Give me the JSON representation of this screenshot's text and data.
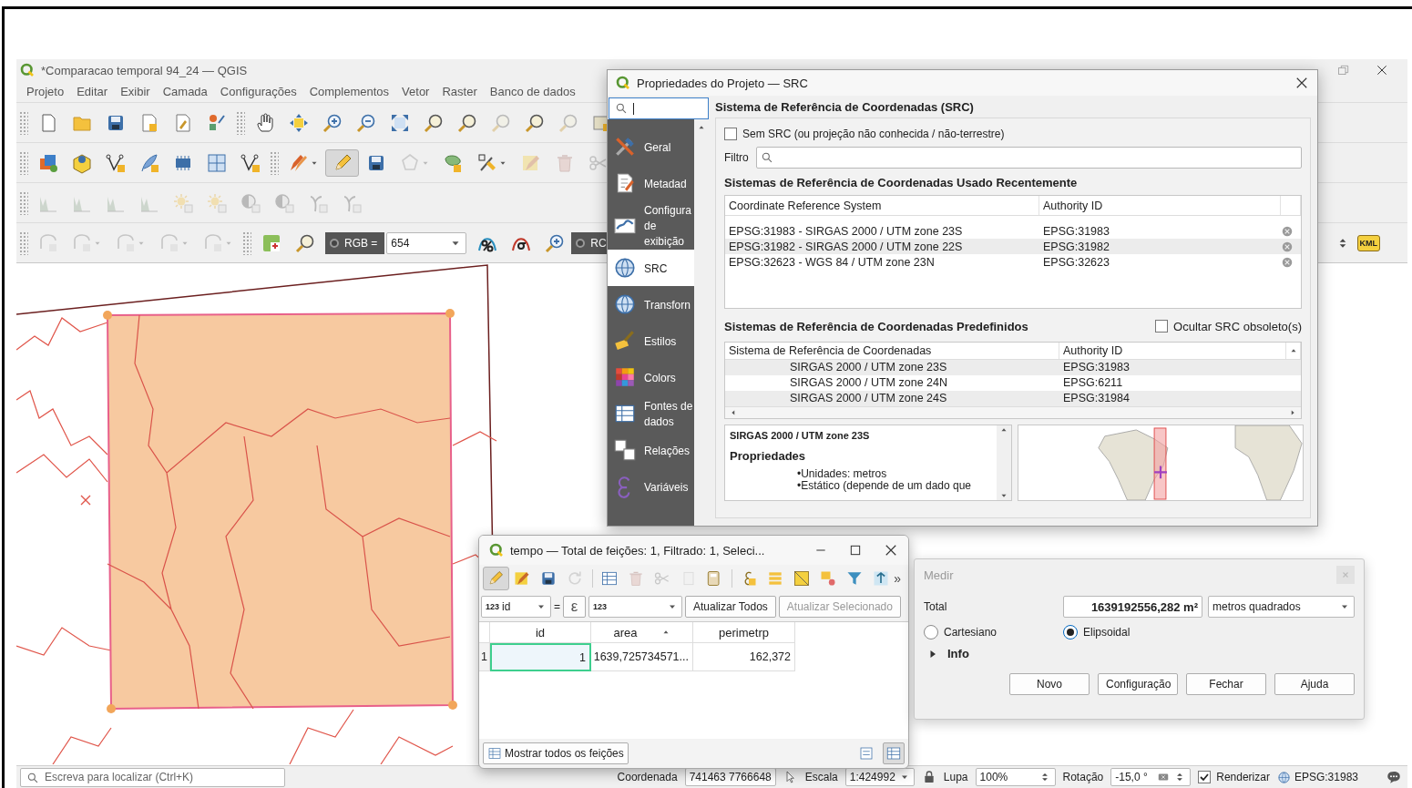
{
  "main_window": {
    "title": "*Comparacao temporal 94_24 — QGIS",
    "menu": [
      "Projeto",
      "Editar",
      "Exibir",
      "Camada",
      "Configurações",
      "Complementos",
      "Vetor",
      "Raster",
      "Banco de dados"
    ],
    "toolbars": [
      {
        "groups": [
          [
            {
              "kind": "page",
              "disabled": false,
              "active": false,
              "menu": false
            },
            {
              "kind": "folder",
              "disabled": false,
              "active": false,
              "menu": false
            },
            {
              "kind": "save",
              "disabled": false,
              "active": false,
              "menu": false
            },
            {
              "kind": "doc-gear",
              "disabled": false,
              "active": false,
              "menu": false
            },
            {
              "kind": "doc",
              "disabled": false,
              "active": false,
              "menu": false
            },
            {
              "kind": "style",
              "disabled": false,
              "active": false,
              "menu": false
            }
          ],
          [
            {
              "kind": "hand",
              "disabled": false,
              "active": false,
              "menu": false
            },
            {
              "kind": "pan",
              "disabled": false,
              "active": false,
              "menu": false
            },
            {
              "kind": "zoom-in",
              "disabled": false,
              "active": false,
              "menu": false
            },
            {
              "kind": "zoom-out",
              "disabled": false,
              "active": false,
              "menu": false
            },
            {
              "kind": "zoom-full",
              "disabled": false,
              "active": false,
              "menu": false
            },
            {
              "kind": "magnifier",
              "disabled": false,
              "active": false,
              "menu": false
            },
            {
              "kind": "magnifier",
              "disabled": false,
              "active": false,
              "menu": false
            },
            {
              "kind": "magnifier",
              "disabled": true,
              "active": false,
              "menu": false
            },
            {
              "kind": "magnifier",
              "disabled": false,
              "active": false,
              "menu": false
            },
            {
              "kind": "magnifier",
              "disabled": true,
              "active": false,
              "menu": false
            },
            {
              "kind": "map",
              "disabled": false,
              "active": false,
              "menu": false
            }
          ]
        ]
      },
      {
        "groups": [
          [
            {
              "kind": "layer",
              "disabled": false,
              "active": false,
              "menu": false
            },
            {
              "kind": "cube",
              "disabled": false,
              "active": false,
              "menu": false
            },
            {
              "kind": "vertex",
              "disabled": false,
              "active": false,
              "menu": false
            },
            {
              "kind": "feather",
              "disabled": false,
              "active": false,
              "menu": false
            },
            {
              "kind": "chip",
              "disabled": false,
              "active": false,
              "menu": false
            },
            {
              "kind": "grid",
              "disabled": false,
              "active": false,
              "menu": false
            },
            {
              "kind": "vertex",
              "disabled": false,
              "active": false,
              "menu": false
            }
          ],
          [
            {
              "kind": "pencils",
              "disabled": false,
              "active": false,
              "menu": true
            },
            {
              "kind": "pencil",
              "disabled": false,
              "active": true,
              "menu": false
            },
            {
              "kind": "save",
              "disabled": false,
              "active": false,
              "menu": false
            },
            {
              "kind": "polygon",
              "disabled": true,
              "active": false,
              "menu": true
            },
            {
              "kind": "blob",
              "disabled": false,
              "active": false,
              "menu": false
            },
            {
              "kind": "tool",
              "disabled": false,
              "active": false,
              "menu": true
            },
            {
              "kind": "edit-table",
              "disabled": true,
              "active": false,
              "menu": false
            },
            {
              "kind": "trash",
              "disabled": true,
              "active": false,
              "menu": false
            },
            {
              "kind": "scissors",
              "disabled": true,
              "active": false,
              "menu": false
            }
          ]
        ]
      },
      {
        "groups": [
          [
            {
              "kind": "histogram",
              "disabled": true,
              "active": false,
              "menu": false
            },
            {
              "kind": "histogram",
              "disabled": true,
              "active": false,
              "menu": false
            },
            {
              "kind": "histogram",
              "disabled": true,
              "active": false,
              "menu": false
            },
            {
              "kind": "histogram",
              "disabled": true,
              "active": false,
              "menu": false
            },
            {
              "kind": "sun",
              "disabled": true,
              "active": false,
              "menu": false
            },
            {
              "kind": "sun",
              "disabled": true,
              "active": false,
              "menu": false
            },
            {
              "kind": "circle",
              "disabled": true,
              "active": false,
              "menu": false
            },
            {
              "kind": "circle",
              "disabled": true,
              "active": false,
              "menu": false
            },
            {
              "kind": "gamma",
              "disabled": true,
              "active": false,
              "menu": false
            },
            {
              "kind": "gamma",
              "disabled": true,
              "active": false,
              "menu": false
            }
          ]
        ]
      },
      {
        "groups": [
          [
            {
              "kind": "shape",
              "disabled": true,
              "active": false,
              "menu": false
            },
            {
              "kind": "shape",
              "disabled": true,
              "active": false,
              "menu": true
            },
            {
              "kind": "shape",
              "disabled": true,
              "active": false,
              "menu": true
            },
            {
              "kind": "shape",
              "disabled": true,
              "active": false,
              "menu": true
            },
            {
              "kind": "shape",
              "disabled": true,
              "active": false,
              "menu": true
            }
          ],
          [
            {
              "kind": "raster",
              "disabled": false,
              "active": false,
              "menu": false
            },
            {
              "kind": "magnifier",
              "disabled": false,
              "active": false,
              "menu": false
            },
            {
              "kind": "rgb-filter",
              "label": "RGB =",
              "value": "654"
            },
            {
              "kind": "percent",
              "disabled": false,
              "active": false,
              "menu": false
            },
            {
              "kind": "sigma",
              "disabled": false,
              "active": false,
              "menu": false
            },
            {
              "kind": "zoom-in",
              "disabled": false,
              "active": false,
              "menu": false
            },
            {
              "kind": "cut-filter",
              "label": "RC"
            }
          ]
        ],
        "right_items": [
          {
            "kind": "spinner"
          },
          {
            "kind": "kml",
            "label": "KML"
          }
        ]
      }
    ],
    "status_bar": {
      "locator_placeholder": "Escreva para localizar (Ctrl+K)",
      "coordinate_label": "Coordenada",
      "coordinate": "741463 7766648",
      "scale_label": "Escala",
      "scale": "1:424992",
      "magnifier_label": "Lupa",
      "magnifier": "100%",
      "rotation_label": "Rotação",
      "rotation": "-15,0 °",
      "render": {
        "label": "Renderizar",
        "checked": true
      },
      "crs": "EPSG:31983"
    }
  },
  "project_properties": {
    "title": "Propriedades do Projeto — SRC",
    "nav": [
      {
        "label": "Geral",
        "kind": "tools",
        "selected": false
      },
      {
        "label": "Metadad",
        "kind": "doc-edit",
        "selected": false
      },
      {
        "label": "Configura de exibição",
        "kind": "map-display",
        "selected": false
      },
      {
        "label": "SRC",
        "kind": "globe",
        "selected": true
      },
      {
        "label": "Transforn",
        "kind": "globe",
        "selected": false
      },
      {
        "label": "Estilos",
        "kind": "brush",
        "selected": false
      },
      {
        "label": "Colors",
        "kind": "colors",
        "selected": false
      },
      {
        "label": "Fontes de dados",
        "kind": "table",
        "selected": false
      },
      {
        "label": "Relações",
        "kind": "tables",
        "selected": false
      },
      {
        "label": "Variáveis",
        "kind": "epsilon",
        "selected": false
      }
    ],
    "heading": "Sistema de Referência de Coordenadas (SRC)",
    "no_crs": {
      "label": "Sem SRC (ou projeção não conhecida / não-terrestre)",
      "checked": false
    },
    "filter_label": "Filtro",
    "recent": {
      "title": "Sistemas de Referência de Coordenadas Usado Recentemente",
      "columns": [
        "Coordinate Reference System",
        "Authority ID"
      ],
      "rows": [
        {
          "crs": "EPSG:31983 - SIRGAS 2000 / UTM zone 23S",
          "authority_id": "EPSG:31983"
        },
        {
          "crs": "EPSG:31982 - SIRGAS 2000 / UTM zone 22S",
          "authority_id": "EPSG:31982"
        },
        {
          "crs": "EPSG:32623 - WGS 84 / UTM zone 23N",
          "authority_id": "EPSG:32623"
        }
      ]
    },
    "predefined": {
      "title": "Sistemas de Referência de Coordenadas Predefinidos",
      "hide_deprecated": {
        "label": "Ocultar SRC obsoleto(s)",
        "checked": false
      },
      "columns": [
        "Sistema de Referência de Coordenadas",
        "Authority ID"
      ],
      "rows": [
        {
          "crs": "SIRGAS 2000 / UTM zone 23S",
          "authority_id": "EPSG:31983"
        },
        {
          "crs": "SIRGAS 2000 / UTM zone 24N",
          "authority_id": "EPSG:6211"
        },
        {
          "crs": "SIRGAS 2000 / UTM zone 24S",
          "authority_id": "EPSG:31984"
        }
      ]
    },
    "details": {
      "title": "SIRGAS 2000 / UTM zone 23S",
      "heading": "Propriedades",
      "bullets": [
        "•Unidades: metros",
        "•Estático (depende de um dado que"
      ]
    }
  },
  "attribute_table": {
    "title": "tempo — Total de feições: 1, Filtrado: 1, Seleci...",
    "toolbar": [
      [
        {
          "kind": "pencil",
          "disabled": false,
          "active": true
        },
        {
          "kind": "edit-table",
          "disabled": false,
          "active": false
        },
        {
          "kind": "save",
          "disabled": false,
          "active": false
        },
        {
          "kind": "refresh",
          "disabled": true,
          "active": false
        }
      ],
      [
        {
          "kind": "table",
          "disabled": false,
          "active": false
        },
        {
          "kind": "trash",
          "disabled": true,
          "active": false
        },
        {
          "kind": "scissors",
          "disabled": true,
          "active": false
        },
        {
          "kind": "copy",
          "disabled": true,
          "active": false
        },
        {
          "kind": "field-calc",
          "disabled": false,
          "active": false
        }
      ],
      [
        {
          "kind": "select-exp",
          "disabled": false,
          "active": false
        },
        {
          "kind": "bars",
          "disabled": false,
          "active": false
        },
        {
          "kind": "triangle",
          "disabled": false,
          "active": false
        },
        {
          "kind": "deselect",
          "disabled": false,
          "active": false
        },
        {
          "kind": "filter",
          "disabled": false,
          "active": false
        },
        {
          "kind": "move-top",
          "disabled": false,
          "active": false
        }
      ]
    ],
    "overflow": "»",
    "field_combo": {
      "badge": "123",
      "value": "id"
    },
    "equals": "=",
    "expression_button": "ε",
    "value_badge": "123",
    "update_all": {
      "label": "Atualizar Todos",
      "disabled": false
    },
    "update_selected": {
      "label": "Atualizar Selecionado",
      "disabled": true
    },
    "columns": [
      {
        "label": "id",
        "sorted": false
      },
      {
        "label": "area",
        "sorted": true
      },
      {
        "label": "perimetrp",
        "sorted": false
      }
    ],
    "rows": [
      {
        "header": "1",
        "cells": [
          {
            "text": "1",
            "selected": true
          },
          {
            "text": "1639,725734571...",
            "selected": false
          },
          {
            "text": "162,372",
            "selected": false
          }
        ]
      }
    ],
    "show_features": "Mostrar todos os feições",
    "views": [
      {
        "kind": "form",
        "selected": false
      },
      {
        "kind": "table",
        "selected": true
      }
    ]
  },
  "measure": {
    "title": "Medir",
    "total_label": "Total",
    "total": "1639192556,282 m²",
    "unit": "metros quadrados",
    "modes": [
      {
        "label": "Cartesiano",
        "selected": false
      },
      {
        "label": "Elipsoidal",
        "selected": true
      }
    ],
    "info": {
      "label": "Info",
      "expanded": false
    },
    "buttons": [
      "Novo",
      "Configuração",
      "Fechar",
      "Ajuda"
    ]
  }
}
